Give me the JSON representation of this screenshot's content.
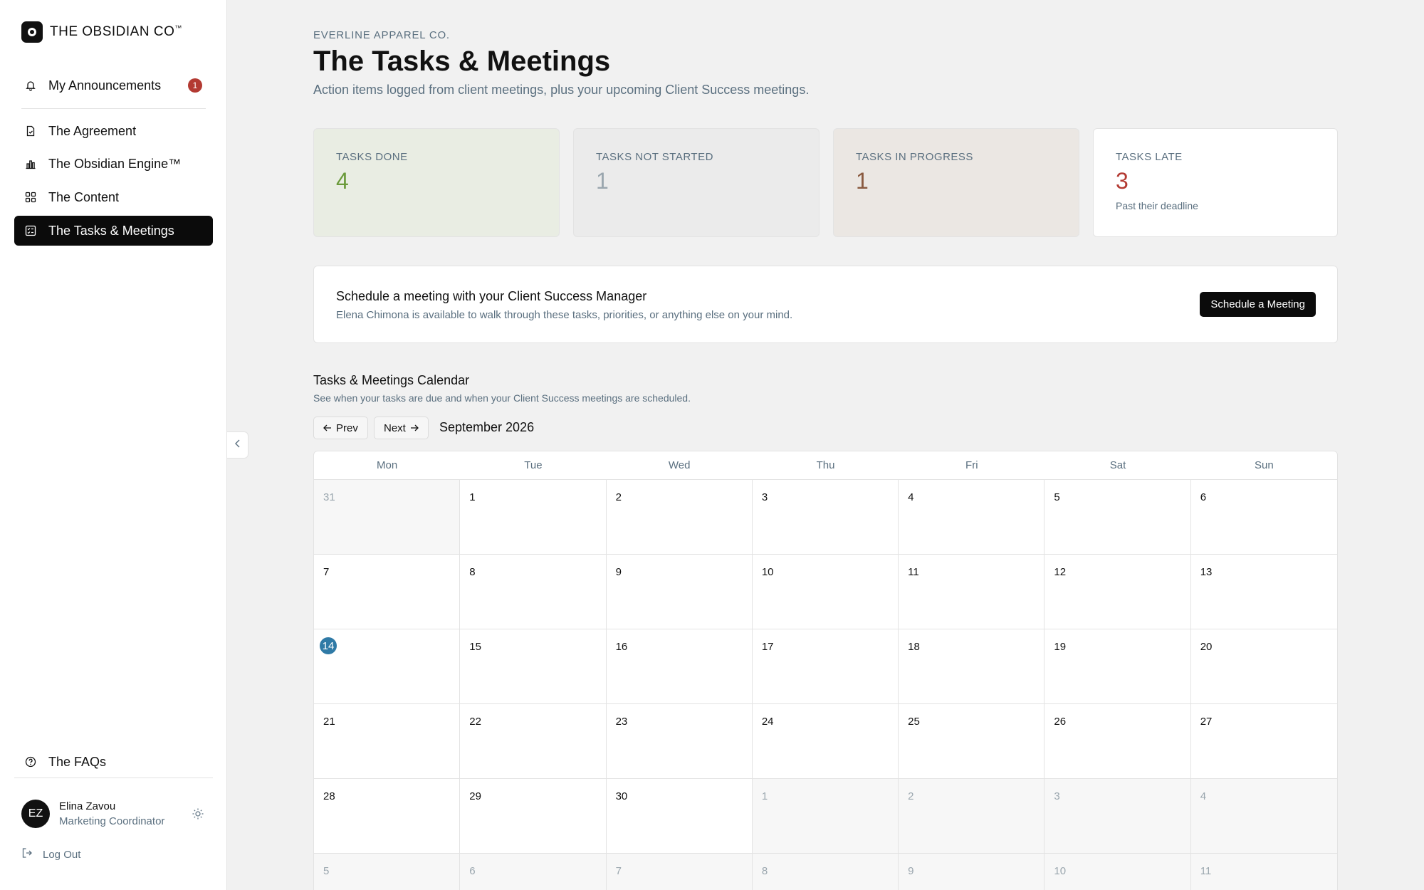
{
  "brand": {
    "name": "THE OBSIDIAN CO",
    "mark": "™"
  },
  "nav": {
    "announcements": {
      "label": "My Announcements",
      "badge": "1"
    },
    "items": [
      {
        "label": "The Agreement",
        "icon": "document-icon"
      },
      {
        "label": "The Obsidian Engine™",
        "icon": "bar-chart-icon"
      },
      {
        "label": "The Content",
        "icon": "grid-icon"
      },
      {
        "label": "The Tasks & Meetings",
        "icon": "checklist-icon",
        "active": true
      }
    ],
    "faqs": "The FAQs"
  },
  "user": {
    "initials": "EZ",
    "name": "Elina Zavou",
    "role": "Marketing Coordinator",
    "logout": "Log Out"
  },
  "header": {
    "eyebrow": "EVERLINE APPAREL CO.",
    "title": "The Tasks & Meetings",
    "subtitle": "Action items logged from client meetings, plus your upcoming Client Success meetings."
  },
  "stats": [
    {
      "label": "TASKS DONE",
      "value": "4",
      "color": "#6a9a3a",
      "bg": "#e9ede3"
    },
    {
      "label": "TASKS NOT STARTED",
      "value": "1",
      "color": "#9aa6ae",
      "bg": "#ebebeb"
    },
    {
      "label": "TASKS IN PROGRESS",
      "value": "1",
      "color": "#8a5a40",
      "bg": "#ebe7e3"
    },
    {
      "label": "TASKS LATE",
      "value": "3",
      "color": "#b33a32",
      "bg": "#ffffff",
      "note": "Past their deadline"
    }
  ],
  "cta": {
    "title": "Schedule a meeting with your Client Success Manager",
    "desc": "Elena Chimona is available to walk through these tasks, priorities, or anything else on your mind.",
    "button": "Schedule a Meeting"
  },
  "calendar": {
    "title": "Tasks & Meetings Calendar",
    "subtitle": "See when your tasks are due and when your Client Success meetings are scheduled.",
    "prev": "Prev",
    "next": "Next",
    "month": "September 2026",
    "weekdays": [
      "Mon",
      "Tue",
      "Wed",
      "Thu",
      "Fri",
      "Sat",
      "Sun"
    ],
    "days": [
      {
        "d": "31",
        "muted": true
      },
      {
        "d": "1"
      },
      {
        "d": "2"
      },
      {
        "d": "3"
      },
      {
        "d": "4"
      },
      {
        "d": "5"
      },
      {
        "d": "6"
      },
      {
        "d": "7"
      },
      {
        "d": "8"
      },
      {
        "d": "9"
      },
      {
        "d": "10"
      },
      {
        "d": "11"
      },
      {
        "d": "12"
      },
      {
        "d": "13"
      },
      {
        "d": "14",
        "today": true
      },
      {
        "d": "15"
      },
      {
        "d": "16"
      },
      {
        "d": "17"
      },
      {
        "d": "18"
      },
      {
        "d": "19"
      },
      {
        "d": "20"
      },
      {
        "d": "21"
      },
      {
        "d": "22"
      },
      {
        "d": "23"
      },
      {
        "d": "24"
      },
      {
        "d": "25"
      },
      {
        "d": "26"
      },
      {
        "d": "27"
      },
      {
        "d": "28"
      },
      {
        "d": "29"
      },
      {
        "d": "30"
      },
      {
        "d": "1",
        "muted": true
      },
      {
        "d": "2",
        "muted": true
      },
      {
        "d": "3",
        "muted": true
      },
      {
        "d": "4",
        "muted": true
      },
      {
        "d": "5",
        "muted": true
      },
      {
        "d": "6",
        "muted": true
      },
      {
        "d": "7",
        "muted": true
      },
      {
        "d": "8",
        "muted": true
      },
      {
        "d": "9",
        "muted": true
      },
      {
        "d": "10",
        "muted": true
      },
      {
        "d": "11",
        "muted": true
      }
    ]
  }
}
